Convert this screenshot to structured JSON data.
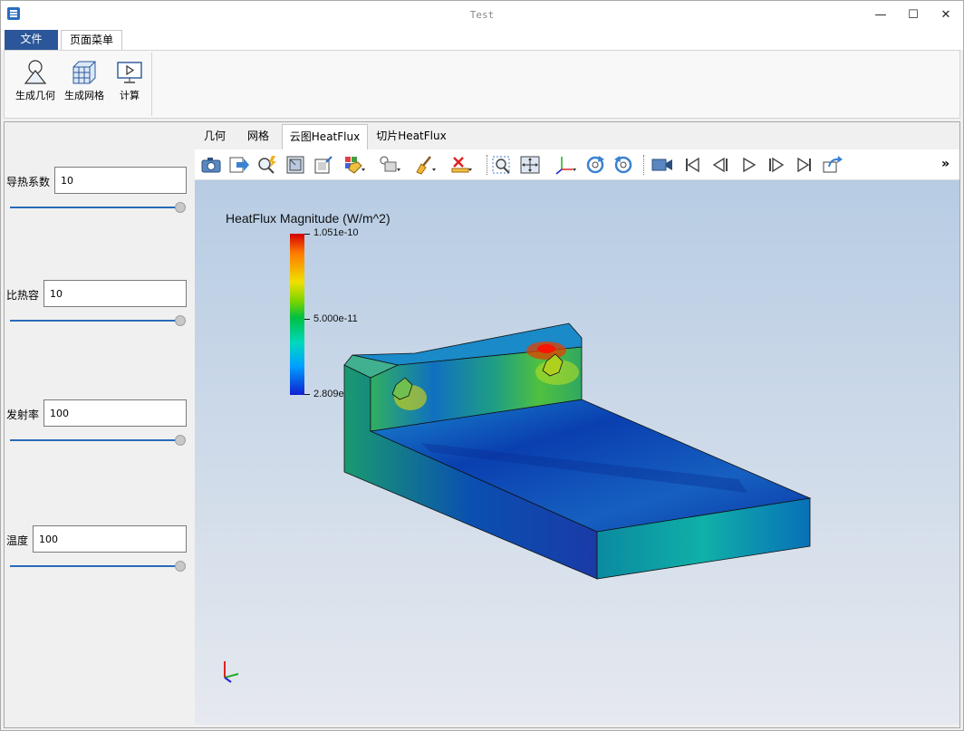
{
  "window": {
    "title": "Test",
    "minimize_glyph": "—",
    "maximize_glyph": "☐",
    "close_glyph": "✕"
  },
  "ribbon": {
    "tabs": [
      {
        "label": "文件"
      },
      {
        "label": "页面菜单"
      }
    ],
    "buttons": [
      {
        "label": "生成几何",
        "icon": "geometry-icon"
      },
      {
        "label": "生成网格",
        "icon": "mesh-icon"
      },
      {
        "label": "计算",
        "icon": "compute-icon"
      }
    ]
  },
  "params": [
    {
      "label": "导热系数",
      "value": "10",
      "slider_fraction": 1.0
    },
    {
      "label": "比热容",
      "value": "10",
      "slider_fraction": 1.0
    },
    {
      "label": "发射率",
      "value": "100",
      "slider_fraction": 1.0
    },
    {
      "label": "温度",
      "value": "100",
      "slider_fraction": 1.0
    }
  ],
  "view_tabs": [
    {
      "label": "几何"
    },
    {
      "label": "网格"
    },
    {
      "label": "云图HeatFlux"
    },
    {
      "label": "切片HeatFlux"
    }
  ],
  "active_view_tab": "云图HeatFlux",
  "toolbar": {
    "icons": [
      "camera-icon",
      "export-icon",
      "search-zoom-icon",
      "frame-icon",
      "edit-view-icon",
      "color-map-icon",
      "probe-icon",
      "brush-icon",
      "remove-icon",
      "zoom-box-icon",
      "fit-view-icon",
      "axes-icon",
      "rotate-cw-icon",
      "rotate-ccw-icon",
      "record-icon",
      "first-frame-icon",
      "prev-frame-icon",
      "play-icon",
      "next-frame-icon",
      "last-frame-icon",
      "loop-icon"
    ],
    "overflow": "»"
  },
  "legend": {
    "title": "HeatFlux Magnitude (W/m^2)",
    "max_label": "1.051e-10",
    "mid_label": "5.000e-11",
    "min_label": "2.809e-12",
    "colors": [
      "#d40000",
      "#f0e000",
      "#00c040",
      "#00a0ff",
      "#1020d0"
    ]
  },
  "colors": {
    "accent": "#2b579a",
    "slider": "#2a6ab8"
  }
}
